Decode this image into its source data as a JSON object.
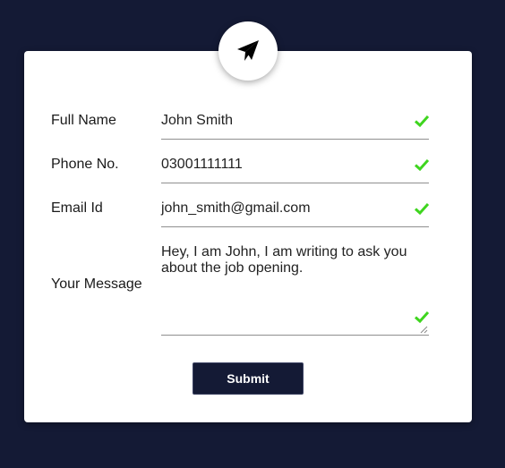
{
  "form": {
    "fields": [
      {
        "label": "Full Name",
        "value": "John Smith",
        "valid": true
      },
      {
        "label": "Phone No.",
        "value": "03001111111",
        "valid": true
      },
      {
        "label": "Email Id",
        "value": "john_smith@gmail.com",
        "valid": true
      },
      {
        "label": "Your Message",
        "value": "Hey, I am John, I am writing to ask you about the job opening.",
        "valid": true
      }
    ],
    "submit_label": "Submit"
  },
  "icons": {
    "header": "paper-plane-icon",
    "valid": "checkmark-icon"
  },
  "colors": {
    "background": "#141a35",
    "card": "#ffffff",
    "valid_check": "#3fd51f",
    "button": "#141a35"
  }
}
